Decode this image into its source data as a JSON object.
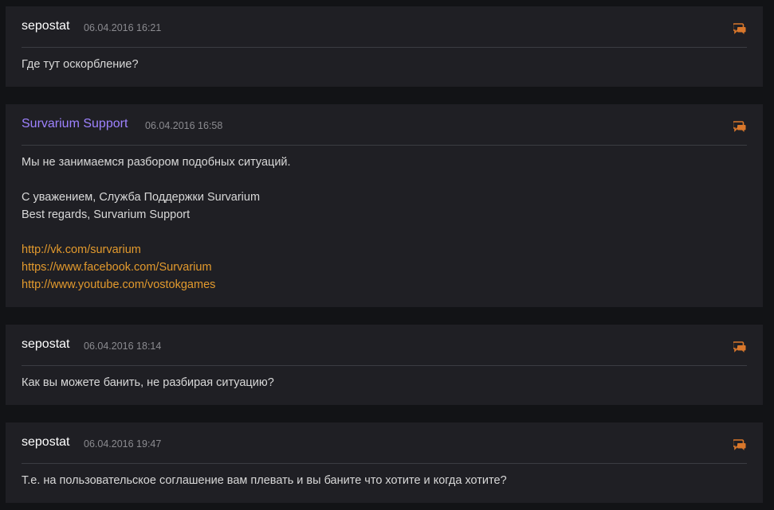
{
  "posts": [
    {
      "author": "sepostat",
      "date": "06.04.2016 16:21",
      "quote_icon": "quote-speech-bubbles-icon",
      "lines": [
        "Где тут оскорбление?"
      ]
    },
    {
      "author": "Survarium Support",
      "author_color": "#9e82ff",
      "date": "06.04.2016 16:58",
      "quote_icon": "quote-speech-bubbles-icon",
      "lines": [
        "Мы не занимаемся разбором подобных ситуаций.",
        "С уважением, Служба Поддержки Survarium",
        "Best regards, Survarium Support"
      ],
      "links": [
        "http://vk.com/survarium",
        "https://www.facebook.com/Survarium",
        "http://www.youtube.com/vostokgames"
      ]
    },
    {
      "author": "sepostat",
      "date": "06.04.2016 18:14",
      "quote_icon": "quote-speech-bubbles-icon",
      "lines": [
        "Как вы можете банить, не разбирая ситуацию?"
      ]
    },
    {
      "author": "sepostat",
      "date": "06.04.2016 19:47",
      "quote_icon": "quote-speech-bubbles-icon",
      "lines": [
        "Т.е. на пользовательское соглашение вам плевать и вы баните что хотите и когда хотите?"
      ]
    }
  ],
  "colors": {
    "page_background": "#121316",
    "post_background": "#1f1f24",
    "link": "#e39a2d",
    "staff_author": "#9e82ff",
    "date": "#8b8b90",
    "icon": "#d9772b"
  }
}
